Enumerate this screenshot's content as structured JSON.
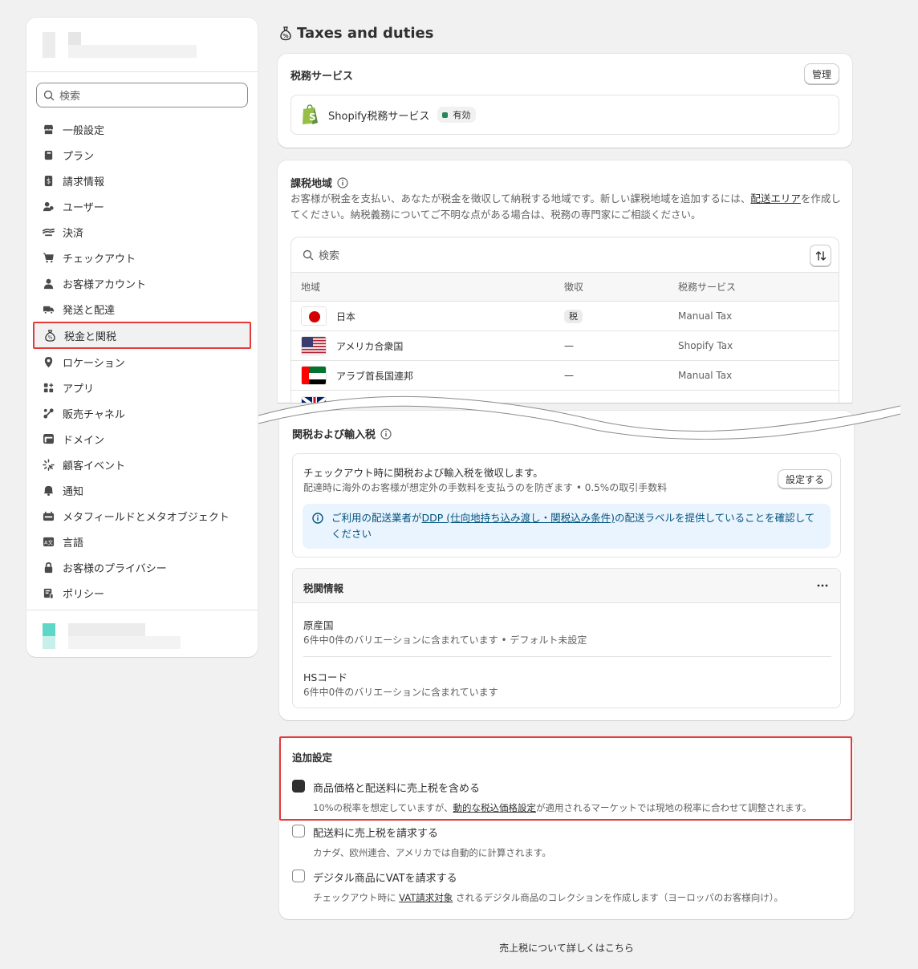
{
  "sidebar": {
    "search_placeholder": "検索",
    "items": [
      {
        "label": "一般設定",
        "icon": "store-icon"
      },
      {
        "label": "プラン",
        "icon": "plan-icon"
      },
      {
        "label": "請求情報",
        "icon": "billing-icon"
      },
      {
        "label": "ユーザー",
        "icon": "users-icon"
      },
      {
        "label": "決済",
        "icon": "payments-icon"
      },
      {
        "label": "チェックアウト",
        "icon": "cart-icon"
      },
      {
        "label": "お客様アカウント",
        "icon": "person-icon"
      },
      {
        "label": "発送と配達",
        "icon": "truck-icon"
      },
      {
        "label": "税金と関税",
        "icon": "tax-bag-icon"
      },
      {
        "label": "ロケーション",
        "icon": "location-icon"
      },
      {
        "label": "アプリ",
        "icon": "apps-icon"
      },
      {
        "label": "販売チャネル",
        "icon": "channels-icon"
      },
      {
        "label": "ドメイン",
        "icon": "domain-icon"
      },
      {
        "label": "顧客イベント",
        "icon": "events-icon"
      },
      {
        "label": "通知",
        "icon": "bell-icon"
      },
      {
        "label": "メタフィールドとメタオブジェクト",
        "icon": "metafields-icon"
      },
      {
        "label": "言語",
        "icon": "language-icon"
      },
      {
        "label": "お客様のプライバシー",
        "icon": "lock-icon"
      },
      {
        "label": "ポリシー",
        "icon": "policy-icon"
      }
    ],
    "active_index": 8
  },
  "page": {
    "title": "Taxes and duties"
  },
  "tax_service": {
    "title": "税務サービス",
    "manage_label": "管理",
    "service_name": "Shopify税務サービス",
    "status": "有効"
  },
  "regions": {
    "title": "課税地域",
    "desc_1": "お客様が税金を支払い、あなたが税金を徴収して納税する地域です。新しい課税地域を追加するには、",
    "desc_link": "配送エリア",
    "desc_2": "を作成してください。納税義務についてご不明な点がある場合は、税務の専門家にご相談ください。",
    "search_placeholder": "検索",
    "headers": [
      "地域",
      "徴収",
      "税務サービス"
    ],
    "rows": [
      {
        "country": "日本",
        "collect": "税",
        "service": "Manual Tax"
      },
      {
        "country": "アメリカ合衆国",
        "collect": "—",
        "service": "Shopify Tax"
      },
      {
        "country": "アラブ首長国連邦",
        "collect": "—",
        "service": "Manual Tax"
      }
    ]
  },
  "duties": {
    "title": "関税および輸入税",
    "box_title": "チェックアウト時に関税および輸入税を徴収します。",
    "box_sub": "配達時に海外のお客様が想定外の手数料を支払うのを防ぎます • 0.5%の取引手数料",
    "setup_label": "設定する",
    "info_1": "ご利用の配送業者が",
    "info_link": "DDP (仕向地持ち込み渡し・関税込み条件)",
    "info_2": "の配送ラベルを提供していることを確認してください",
    "customs_title": "税関情報",
    "origin_title": "原産国",
    "origin_sub": "6件中0件のバリエーションに含まれています • デフォルト未設定",
    "hs_title": "HSコード",
    "hs_sub": "6件中0件のバリエーションに含まれています"
  },
  "additional": {
    "title": "追加設定",
    "options": [
      {
        "label": "商品価格と配送料に売上税を含める",
        "checked": true,
        "sub_1": "10%の税率を想定していますが、",
        "sub_link": "動的な税込価格設定",
        "sub_2": "が適用されるマーケットでは現地の税率に合わせて調整されます。"
      },
      {
        "label": "配送料に売上税を請求する",
        "checked": false,
        "sub_1": "カナダ、欧州連合、アメリカでは自動的に計算されます。",
        "sub_link": "",
        "sub_2": ""
      },
      {
        "label": "デジタル商品にVATを請求する",
        "checked": false,
        "sub_1": "チェックアウト時に ",
        "sub_link": "VAT請求対象",
        "sub_2": " されるデジタル商品のコレクションを作成します（ヨーロッパのお客様向け）。"
      }
    ]
  },
  "footer_link": "売上税について詳しくはこちら",
  "colors": {
    "highlight": "#e43a3a",
    "info_bg": "#eaf4ff",
    "active_badge": "#29845a"
  }
}
